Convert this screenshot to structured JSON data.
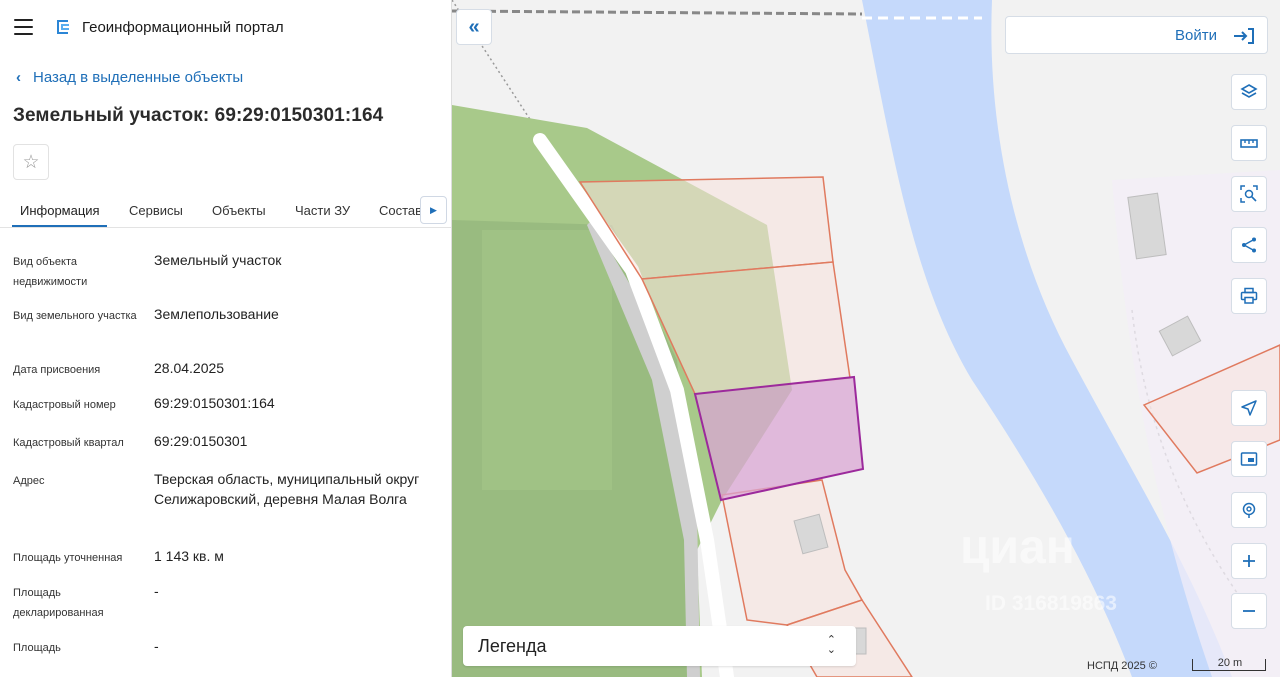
{
  "header": {
    "portal_title": "Геоинформационный портал"
  },
  "nav": {
    "back_label": "Назад в выделенные объекты"
  },
  "object": {
    "title": "Земельный участок: 69:29:0150301:164"
  },
  "tabs": [
    {
      "label": "Информация",
      "active": true
    },
    {
      "label": "Сервисы",
      "active": false
    },
    {
      "label": "Объекты",
      "active": false
    },
    {
      "label": "Части ЗУ",
      "active": false
    },
    {
      "label": "Состав",
      "active": false
    }
  ],
  "info": [
    {
      "label": "Вид объекта недвижимости",
      "value": "Земельный участок"
    },
    {
      "label": "Вид земельного участка",
      "value": "Землепользование"
    },
    {
      "label": "Дата присвоения",
      "value": "28.04.2025"
    },
    {
      "label": "Кадастровый номер",
      "value": "69:29:0150301:164"
    },
    {
      "label": "Кадастровый квартал",
      "value": "69:29:0150301"
    },
    {
      "label": "Адрес",
      "value": "Тверская область, муниципальный округ Селижаровский, деревня Малая Волга"
    },
    {
      "label": "Площадь уточненная",
      "value": "1 143 кв. м"
    },
    {
      "label": "Площадь декларированная",
      "value": "-"
    },
    {
      "label": "Площадь",
      "value": "-"
    }
  ],
  "map": {
    "login_label": "Войти",
    "legend_label": "Легенда",
    "copyright": "НСПД 2025 ©",
    "scale_label": "20 m",
    "watermark_text": "циан",
    "watermark_id": "ID 316819863",
    "colors": {
      "river": "#c5d9fb",
      "forest": "#a8c98a",
      "parcel_outline": "#e07a5f",
      "parcel_fill": "#f7e1dd",
      "selected_outline": "#9c2a9c",
      "selected_fill": "#d9a6d3",
      "accent": "#1f6fb8"
    }
  },
  "tools": [
    {
      "name": "layers-icon"
    },
    {
      "name": "ruler-icon"
    },
    {
      "name": "area-search-icon"
    },
    {
      "name": "share-icon"
    },
    {
      "name": "print-icon"
    },
    {
      "name": "locate-icon"
    },
    {
      "name": "minimap-icon"
    },
    {
      "name": "geolocation-icon"
    },
    {
      "name": "zoom-in-icon"
    },
    {
      "name": "zoom-out-icon"
    }
  ]
}
